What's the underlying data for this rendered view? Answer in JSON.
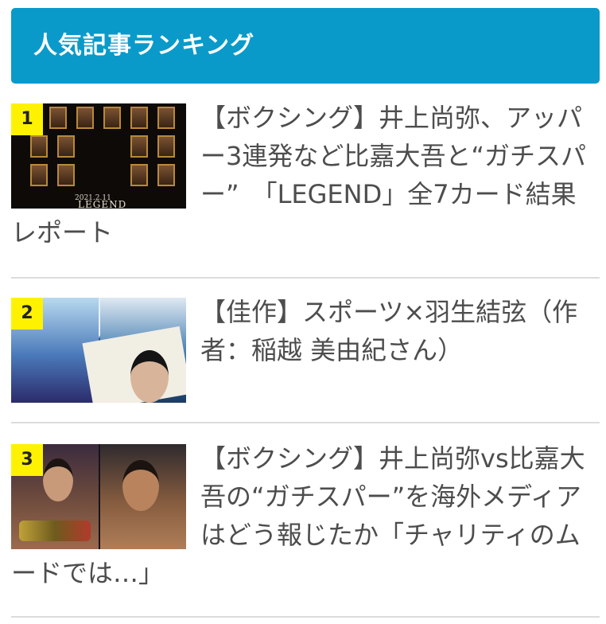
{
  "header": {
    "title": "人気記事ランキング"
  },
  "articles": [
    {
      "rank": "1",
      "title": "【ボクシング】井上尚弥、アッパー3連発など比嘉大吾と“ガチスパー”　「LEGEND」全7カード結果レポート",
      "thumbnail": {
        "icon": "boxing-poster-thumbnail",
        "caption_date": "2021.2.11",
        "logo_text": "LEGEND"
      }
    },
    {
      "rank": "2",
      "title": "【佳作】スポーツ×羽生結弦（作者：稲越 美由紀さん）",
      "thumbnail": {
        "icon": "figure-skater-collage-thumbnail"
      }
    },
    {
      "rank": "3",
      "title": "【ボクシング】井上尚弥vs比嘉大吾の“ガチスパー”を海外メディアはどう報じたか「チャリティのムードでは…」",
      "thumbnail": {
        "icon": "boxers-photo-thumbnail"
      }
    }
  ],
  "colors": {
    "header_bg": "#0a9ac9",
    "rank_badge_bg": "#fff200",
    "separator": "#dcdcdc",
    "title_text": "#4d4d4d"
  }
}
